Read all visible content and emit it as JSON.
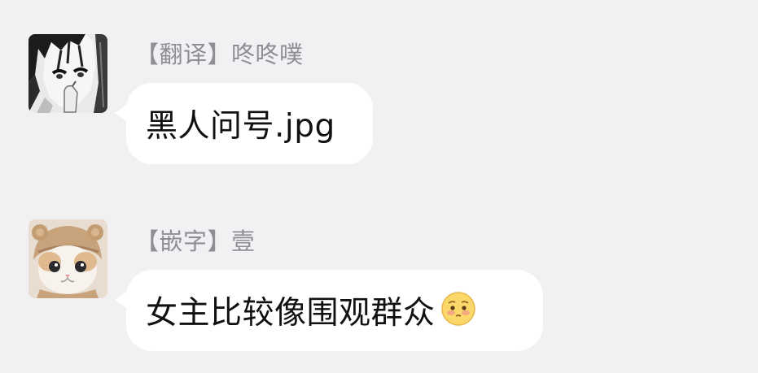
{
  "messages": [
    {
      "sender": "【翻译】咚咚噗",
      "text": "黑人问号.jpg",
      "avatar_icon": "manga-boy-avatar"
    },
    {
      "sender": "【嵌字】壹",
      "text": "女主比较像围观群众",
      "avatar_icon": "cat-in-hat-avatar",
      "emoji": "pleading-face-emoji"
    }
  ],
  "colors": {
    "background": "#f1f1f3",
    "bubble": "#ffffff",
    "sender_text": "#8e8e93",
    "message_text": "#111111"
  }
}
